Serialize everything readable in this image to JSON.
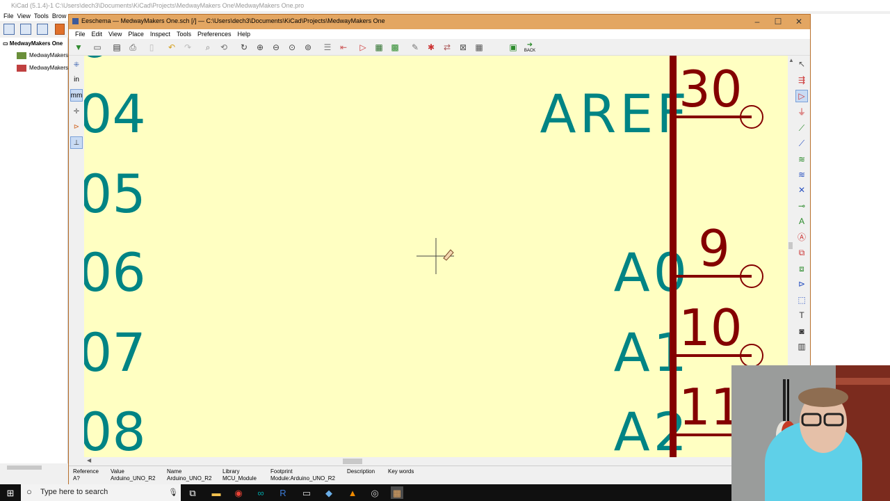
{
  "project_manager": {
    "title": "KiCad (5.1.4)-1 C:\\Users\\dech3\\Documents\\KiCad\\Projects\\MedwayMakers One\\MedwayMakers One.pro",
    "menu": [
      "File",
      "View",
      "Tools",
      "Brow"
    ],
    "tree": [
      "MedwayMakers One",
      "MedwayMakers",
      "MedwayMakers"
    ]
  },
  "window": {
    "title": "Eeschema — MedwayMakers One.sch [/] — C:\\Users\\dech3\\Documents\\KiCad\\Projects\\MedwayMakers One",
    "menu": [
      "File",
      "Edit",
      "View",
      "Place",
      "Inspect",
      "Tools",
      "Preferences",
      "Help"
    ],
    "back_label": "BACK",
    "units": {
      "inch": "in",
      "mm": "mm"
    }
  },
  "schematic": {
    "left_pins": [
      "04",
      "05",
      "06",
      "07",
      "08"
    ],
    "right_pin_names": [
      "AREF",
      "A0",
      "A1",
      "A2"
    ],
    "pin_numbers": [
      "30",
      "9",
      "10",
      "11"
    ]
  },
  "status": {
    "reference_label": "Reference",
    "reference_value": "A?",
    "value_label": "Value",
    "value_value": "Arduino_UNO_R2",
    "name_label": "Name",
    "name_value": "Arduino_UNO_R2",
    "library_label": "Library",
    "library_value": "MCU_Module",
    "footprint_label": "Footprint",
    "footprint_value": "Module:Arduino_UNO_R2",
    "description_label": "Description",
    "keywords_label": "Key words"
  },
  "taskbar": {
    "search_placeholder": "Type here to search"
  },
  "colors": {
    "canvas": "#ffffc2",
    "pin_name": "#008484",
    "component": "#840000",
    "window_title": "#e3a662"
  }
}
